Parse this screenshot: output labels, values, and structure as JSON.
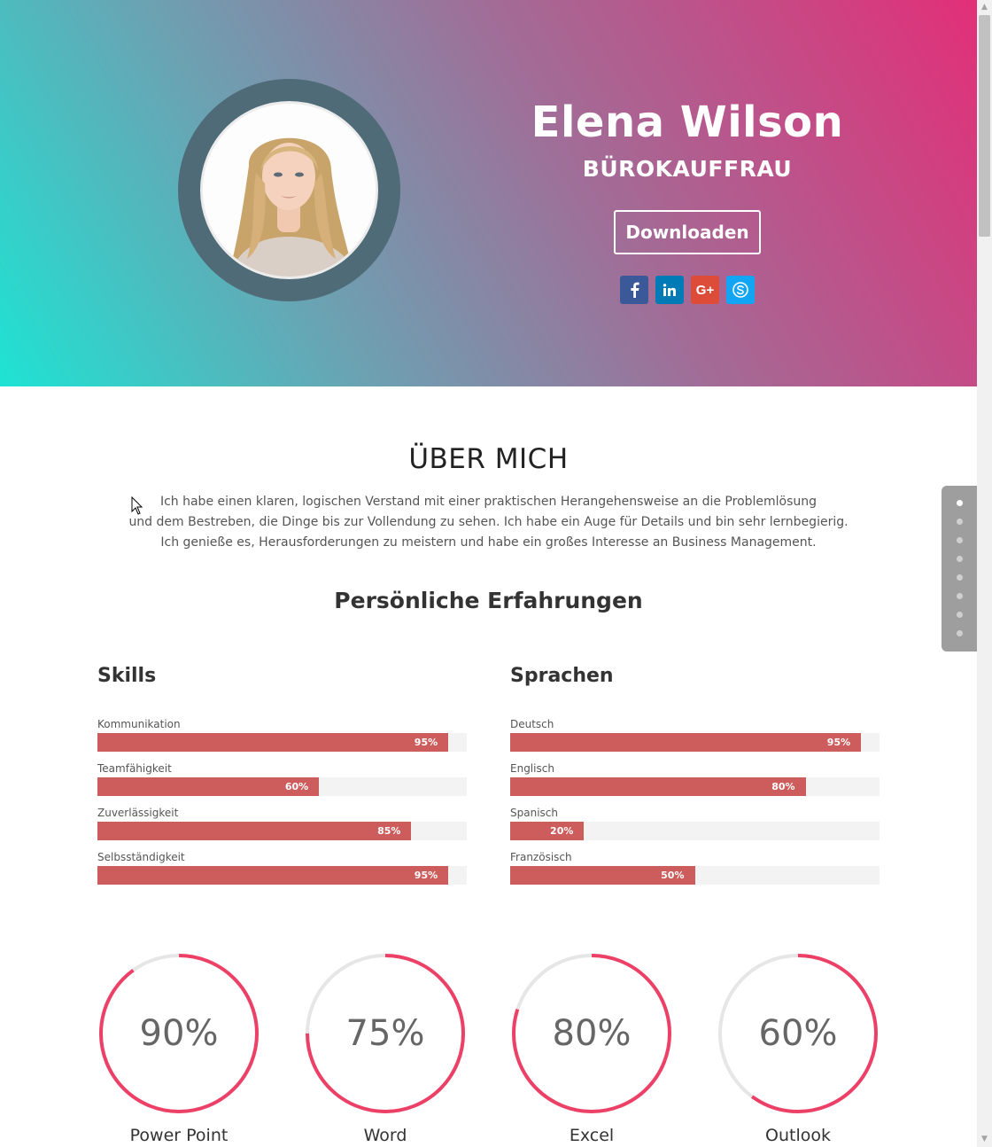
{
  "hero": {
    "name": "Elena Wilson",
    "job_title": "BÜROKAUFFRAU",
    "download_label": "Downloaden",
    "socials": [
      {
        "icon": "facebook-icon",
        "glyph": "f",
        "color": "#3b5998"
      },
      {
        "icon": "linkedin-icon",
        "glyph": "in",
        "color": "#007bb6"
      },
      {
        "icon": "google-plus-icon",
        "glyph": "G+",
        "color": "#dd4b39"
      },
      {
        "icon": "skype-icon",
        "glyph": "S",
        "color": "#12a5f4"
      }
    ]
  },
  "about": {
    "heading": "ÜBER MICH",
    "lines": [
      "Ich habe einen klaren, logischen Verstand mit einer praktischen Herangehensweise an die Problemlösung",
      "und dem Bestreben, die Dinge bis zur Vollendung zu sehen. Ich habe ein Auge für Details und bin sehr lernbegierig.",
      "Ich genieße es, Herausforderungen zu meistern und habe ein großes Interesse an Business Management."
    ]
  },
  "experience": {
    "heading": "Persönliche Erfahrungen",
    "skills": {
      "heading": "Skills",
      "items": [
        {
          "label": "Kommunikation",
          "percent": 95,
          "percent_text": "95%"
        },
        {
          "label": "Teamfähigkeit",
          "percent": 60,
          "percent_text": "60%"
        },
        {
          "label": "Zuverlässigkeit",
          "percent": 85,
          "percent_text": "85%"
        },
        {
          "label": "Selbsständigkeit",
          "percent": 95,
          "percent_text": "95%"
        }
      ]
    },
    "languages": {
      "heading": "Sprachen",
      "items": [
        {
          "label": "Deutsch",
          "percent": 95,
          "percent_text": "95%"
        },
        {
          "label": "Englisch",
          "percent": 80,
          "percent_text": "80%"
        },
        {
          "label": "Spanisch",
          "percent": 20,
          "percent_text": "20%"
        },
        {
          "label": "Französisch",
          "percent": 50,
          "percent_text": "50%"
        }
      ]
    }
  },
  "circles": [
    {
      "label": "Power Point",
      "percent": 90,
      "percent_text": "90%"
    },
    {
      "label": "Word",
      "percent": 75,
      "percent_text": "75%"
    },
    {
      "label": "Excel",
      "percent": 80,
      "percent_text": "80%"
    },
    {
      "label": "Outlook",
      "percent": 60,
      "percent_text": "60%"
    }
  ],
  "colors": {
    "bar_fill": "#cd5c5c",
    "bar_track": "#f3f3f3",
    "circle_arc": "#ec4067",
    "circle_track": "#e6e6e6"
  },
  "dotnav": {
    "count": 8,
    "active_index": 0
  }
}
